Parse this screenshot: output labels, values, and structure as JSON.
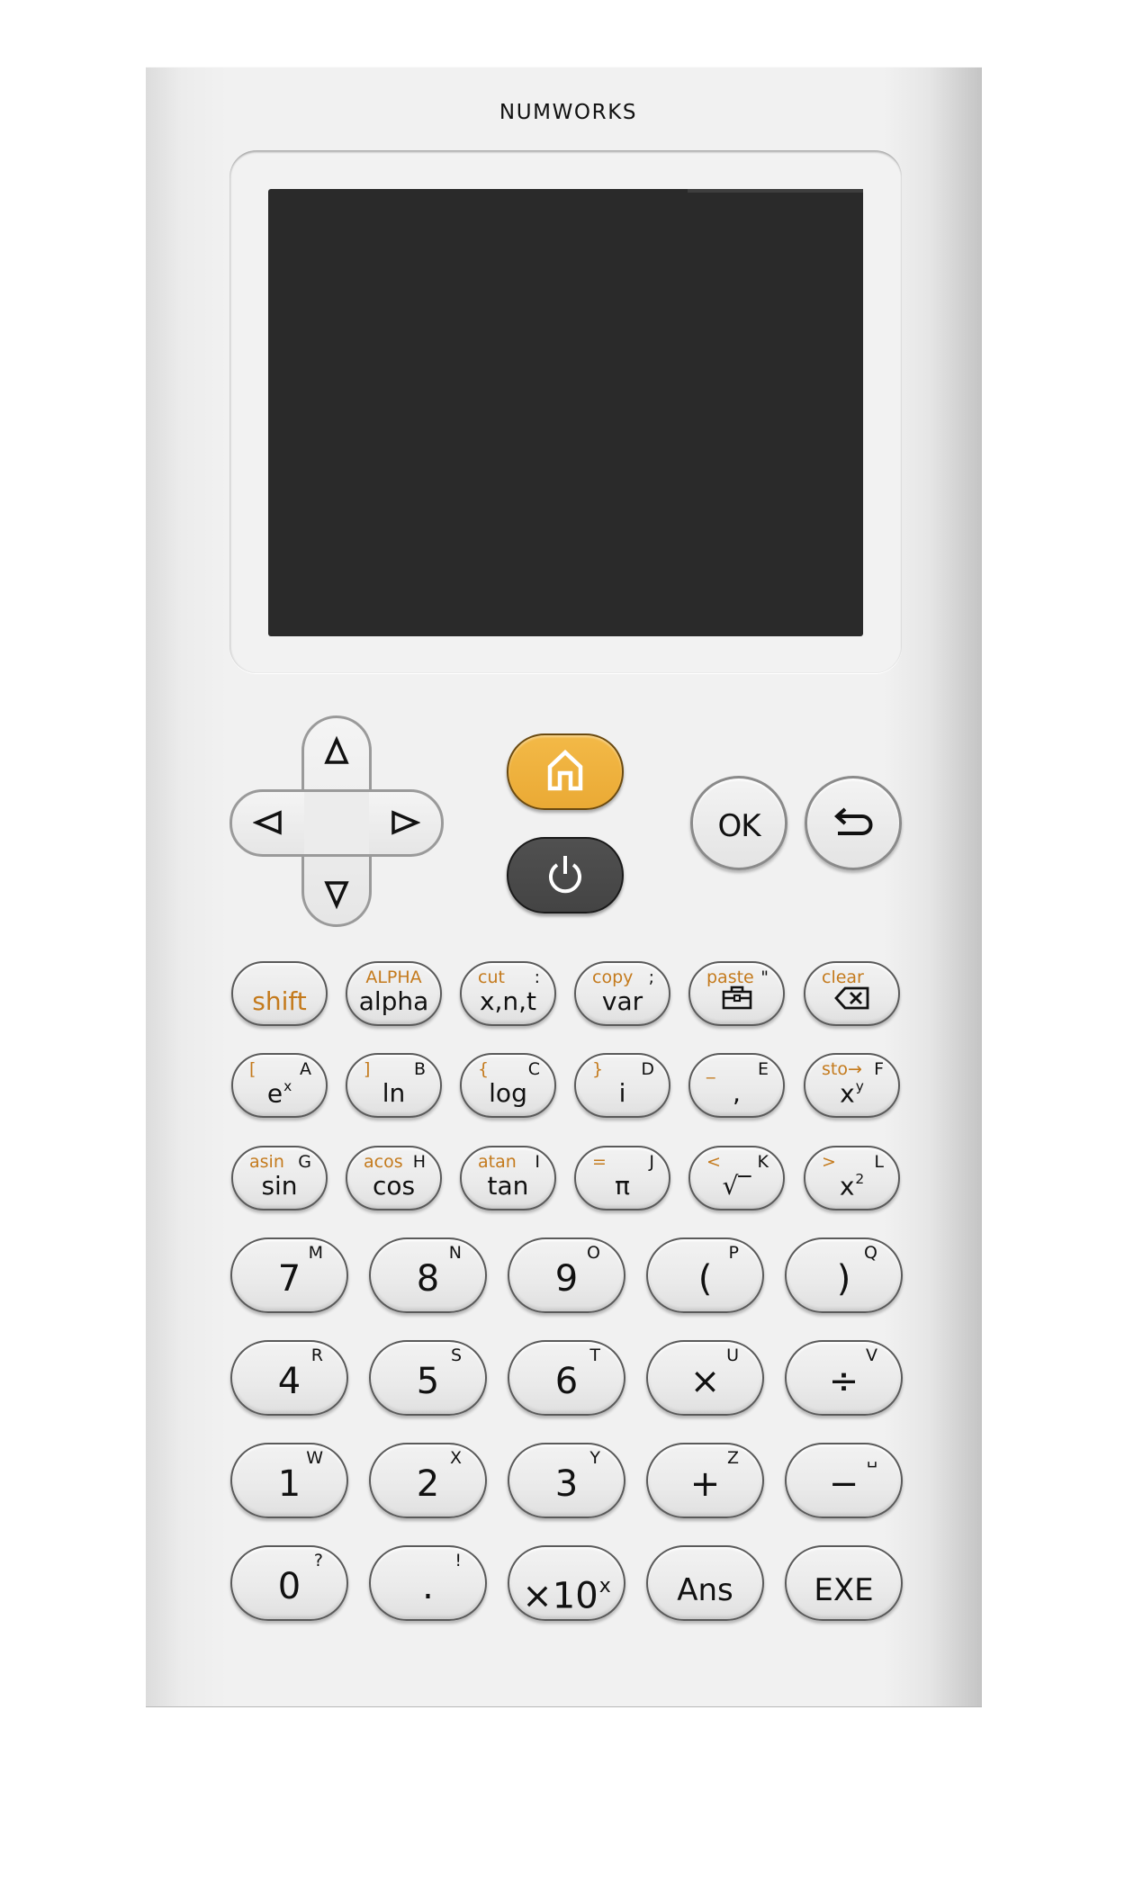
{
  "device": {
    "brand": "NUMWORKS"
  },
  "screen": {
    "state": "off",
    "color": "#2a2a2a"
  },
  "colors": {
    "body": "#f1f1f1",
    "secondary_label": "#c47a1c",
    "home_key": "#f0b23e",
    "power_key": "#4a4a4a"
  },
  "navigation": {
    "dpad": [
      "up-arrow",
      "left-arrow",
      "right-arrow",
      "down-arrow"
    ],
    "home_icon": "home-icon",
    "power_icon": "power-icon",
    "ok_label": "OK",
    "back_icon": "back-icon"
  },
  "function_rows": [
    [
      {
        "main": "shift",
        "main_orange": true
      },
      {
        "main": "alpha",
        "sec": "ALPHA",
        "sec_center": true
      },
      {
        "main": "x,n,t",
        "sec": "cut",
        "alpha": ":"
      },
      {
        "main": "var",
        "sec": "copy",
        "alpha": ";"
      },
      {
        "main_icon": "toolbox-icon",
        "sec": "paste",
        "alpha": "\""
      },
      {
        "main_icon": "backspace-icon",
        "sec": "clear"
      }
    ],
    [
      {
        "main": "e",
        "sup": "x",
        "sec": "[",
        "alpha": "A"
      },
      {
        "main": "ln",
        "sec": "]",
        "alpha": "B"
      },
      {
        "main": "log",
        "sec": "{",
        "alpha": "C"
      },
      {
        "main": "i",
        "sec": "}",
        "alpha": "D"
      },
      {
        "main": ",",
        "sec": "_",
        "alpha": "E"
      },
      {
        "main": "x",
        "sup": "y",
        "sec": "sto→",
        "alpha": "F"
      }
    ],
    [
      {
        "main": "sin",
        "sec": "asin",
        "alpha": "G"
      },
      {
        "main": "cos",
        "sec": "acos",
        "alpha": "H"
      },
      {
        "main": "tan",
        "sec": "atan",
        "alpha": "I"
      },
      {
        "main": "π",
        "sec": "=",
        "alpha": "J"
      },
      {
        "main": "√‾",
        "sec": "<",
        "alpha": "K"
      },
      {
        "main": "x",
        "sup": "2",
        "sec": ">",
        "alpha": "L"
      }
    ]
  ],
  "number_rows": [
    [
      {
        "main": "7",
        "alpha": "M"
      },
      {
        "main": "8",
        "alpha": "N"
      },
      {
        "main": "9",
        "alpha": "O"
      },
      {
        "main": "(",
        "alpha": "P"
      },
      {
        "main": ")",
        "alpha": "Q"
      }
    ],
    [
      {
        "main": "4",
        "alpha": "R"
      },
      {
        "main": "5",
        "alpha": "S"
      },
      {
        "main": "6",
        "alpha": "T"
      },
      {
        "main": "×",
        "alpha": "U"
      },
      {
        "main": "÷",
        "alpha": "V"
      }
    ],
    [
      {
        "main": "1",
        "alpha": "W"
      },
      {
        "main": "2",
        "alpha": "X"
      },
      {
        "main": "3",
        "alpha": "Y"
      },
      {
        "main": "+",
        "alpha": "Z"
      },
      {
        "main": "−",
        "alpha": "␣"
      }
    ],
    [
      {
        "main": "0",
        "alpha": "?"
      },
      {
        "main": ".",
        "alpha": "!"
      },
      {
        "main": "×10",
        "sup": "x"
      },
      {
        "main": "Ans",
        "word": true
      },
      {
        "main": "EXE",
        "word": true
      }
    ]
  ]
}
